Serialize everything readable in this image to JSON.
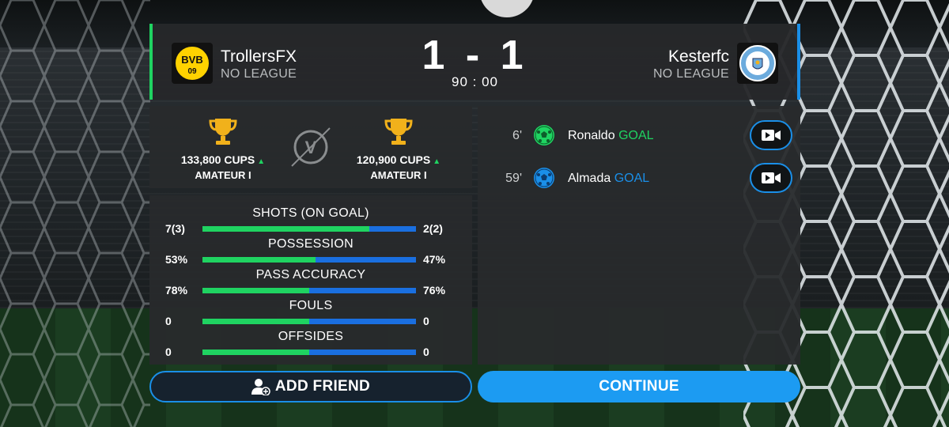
{
  "match": {
    "home": {
      "name": "TrollersFX",
      "league": "NO LEAGUE",
      "crest_text": "BVB",
      "crest_year": "09",
      "cups": "133,800 CUPS",
      "division": "AMATEUR I",
      "accent": "#1fd361"
    },
    "away": {
      "name": "Kesterfc",
      "league": "NO LEAGUE",
      "crest_text": "MANCHESTER CITY",
      "cups": "120,900 CUPS",
      "division": "AMATEUR I",
      "accent": "#1a8fe8"
    },
    "score": "1 - 1",
    "time": "90 : 00",
    "versus_letter": "V"
  },
  "stats": [
    {
      "title": "SHOTS (ON GOAL)",
      "home": "7(3)",
      "away": "2(2)",
      "home_share": 0.78
    },
    {
      "title": "POSSESSION",
      "home": "53%",
      "away": "47%",
      "home_share": 0.53
    },
    {
      "title": "PASS ACCURACY",
      "home": "78%",
      "away": "76%",
      "home_share": 0.5
    },
    {
      "title": "FOULS",
      "home": "0",
      "away": "0",
      "home_share": 0.5
    },
    {
      "title": "OFFSIDES",
      "home": "0",
      "away": "0",
      "home_share": 0.5
    }
  ],
  "events": [
    {
      "minute": "6'",
      "player": "Ronaldo",
      "type": "GOAL",
      "team": "home",
      "color": "#1fd361",
      "icon": "green-ball-icon"
    },
    {
      "minute": "59'",
      "player": "Almada",
      "type": "GOAL",
      "team": "away",
      "color": "#1a8fe8",
      "icon": "blue-ball-icon"
    }
  ],
  "buttons": {
    "add_friend": "ADD FRIEND",
    "continue": "CONTINUE"
  },
  "colors": {
    "home": "#1fd361",
    "away": "#1a6fe0",
    "button_blue": "#1c9bf2",
    "trophy": "#f1b11b"
  }
}
